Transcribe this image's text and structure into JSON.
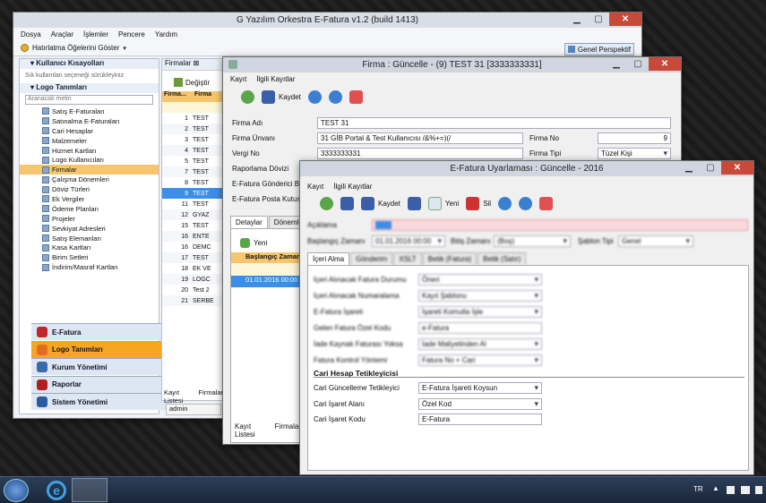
{
  "main_window": {
    "title": "G Yazılım Orkestra E-Fatura v1.2 (build 1413)",
    "menu": [
      "Dosya",
      "Araçlar",
      "İşlemler",
      "Pencere",
      "Yardım"
    ],
    "reminder_button": "Hatırlatma Öğelerini Göster",
    "perspective_button": "Genel Perspektif",
    "shortcuts_title": "Kullanıcı Kısayolları",
    "shortcuts_hint": "Sık kullanılan seçeneği sürükleyiniz",
    "logo_title": "Logo Tanımları",
    "search_placeholder": "Aranacak metin",
    "tree": [
      "Satış E-Faturaları",
      "Satınalma E-Faturaları",
      "Cari Hesaplar",
      "Malzemeler",
      "Hizmet Kartları",
      "Logo Kullanıcıları",
      "Firmalar",
      "Çalışma Dönemleri",
      "Döviz Türleri",
      "Ek Vergiler",
      "Ödeme Planları",
      "Projeler",
      "Sevkiyat Adresleri",
      "Satış Elemanları",
      "Kasa Kartları",
      "Birim Setleri",
      "İndirim/Masraf Kartları"
    ],
    "groups": [
      "E-Fatura",
      "Logo Tanımları",
      "Kurum Yönetimi",
      "Raporlar",
      "Sistem Yönetimi"
    ],
    "status_user": "admin"
  },
  "firmalar_panel": {
    "tab": "Firmalar",
    "change_button": "Değiştir",
    "col_no": "Firma...",
    "col_name": "Firma",
    "rows": [
      {
        "n": "1",
        "t": "TEST"
      },
      {
        "n": "2",
        "t": "TEST"
      },
      {
        "n": "3",
        "t": "TEST"
      },
      {
        "n": "4",
        "t": "TEST"
      },
      {
        "n": "5",
        "t": "TEST"
      },
      {
        "n": "7",
        "t": "TEST"
      },
      {
        "n": "8",
        "t": "TEST"
      },
      {
        "n": "9",
        "t": "TEST"
      },
      {
        "n": "11",
        "t": "TEST"
      },
      {
        "n": "12",
        "t": "GYAZ"
      },
      {
        "n": "15",
        "t": "TEST"
      },
      {
        "n": "16",
        "t": "ENTE"
      },
      {
        "n": "16",
        "t": "DEMC"
      },
      {
        "n": "17",
        "t": "TEST"
      },
      {
        "n": "18",
        "t": "EK VE"
      },
      {
        "n": "19",
        "t": "LOGC"
      },
      {
        "n": "20",
        "t": "Test 2"
      },
      {
        "n": "21",
        "t": "SERBE"
      }
    ],
    "bottom_tabs": [
      "Kayıt Listesi",
      "Firmalar"
    ]
  },
  "firma_window": {
    "title": "Firma : Güncelle - (9) TEST 31 [3333333331]",
    "menu": [
      "Kayıt",
      "İlgili Kayıtlar"
    ],
    "save": "Kaydet",
    "labels": {
      "name": "Firma Adı",
      "title": "Firma Ünvanı",
      "tax": "Vergi No",
      "report_cur": "Raporlama Dövizi",
      "sender": "E-Fatura Gönderici B",
      "mailbox": "E-Fatura Posta Kutus",
      "no": "Firma No",
      "type": "Firma Tipi"
    },
    "values": {
      "name": "TEST 31",
      "title": "31 GİB Portal & Test Kullanıcısı /&%+=)(/",
      "tax": "3333333331",
      "no": "9",
      "type": "Tüzel Kişi"
    },
    "tabs": [
      "Detaylar",
      "Dönemler"
    ],
    "new": "Yeni",
    "period_col": "Başlangıç Zamanı",
    "period_row": "01.01.2016 00:00",
    "bottom_tabs": [
      "Kayıt Listesi",
      "Firmalar"
    ]
  },
  "efatura_window": {
    "title": "E-Fatura Uyarlaması : Güncelle - 2016",
    "menu": [
      "Kayıt",
      "İlgili Kayıtlar"
    ],
    "save": "Kaydet",
    "new": "Yeni",
    "delete": "Sil",
    "desc_label": "Açıklama",
    "start_label": "Başlangıç Zamanı",
    "start_value": "01.01.2016 00:00",
    "end_label": "Bitiş Zamanı",
    "end_value": "(Boş)",
    "template_label": "Şablon Tipi",
    "template_value": "Genel",
    "tabs": [
      "İçeri Alma",
      "Gönderim",
      "XSLT",
      "Betik (Fatura)",
      "Betik (Satır)"
    ],
    "blurred_rows": [
      {
        "l": "İçeri Alınacak Fatura Durumu",
        "v": "Öneri"
      },
      {
        "l": "İçeri Alınacak Numaralama",
        "v": "Kayıt Şablonu"
      },
      {
        "l": "E-Fatura İşareti",
        "v": "İşareti Komutla İşle"
      },
      {
        "l": "Gelen Fatura Özel Kodu",
        "v": "e-Fatura"
      },
      {
        "l": "İade Kaynak Faturası Yoksa",
        "v": "İade Maliyetinden Al"
      },
      {
        "l": "Fatura Kontrol Yöntemi",
        "v": "Fatura No + Cari"
      }
    ],
    "section": "Cari Hesap Tetikleyicisi",
    "rows": [
      {
        "l": "Cari Güncelleme Tetikleyici",
        "v": "E-Fatura İşareti Koysun"
      },
      {
        "l": "Cari İşaret Alanı",
        "v": "Özel Kod"
      },
      {
        "l": "Cari İşaret Kodu",
        "v": "E-Fatura"
      }
    ]
  },
  "taskbar": {
    "lang": "TR",
    "time": "",
    "date": ""
  },
  "colors": {
    "accent_red": "#c7493a",
    "selection": "#3d8ee6",
    "group_orange": "#f5a623"
  }
}
